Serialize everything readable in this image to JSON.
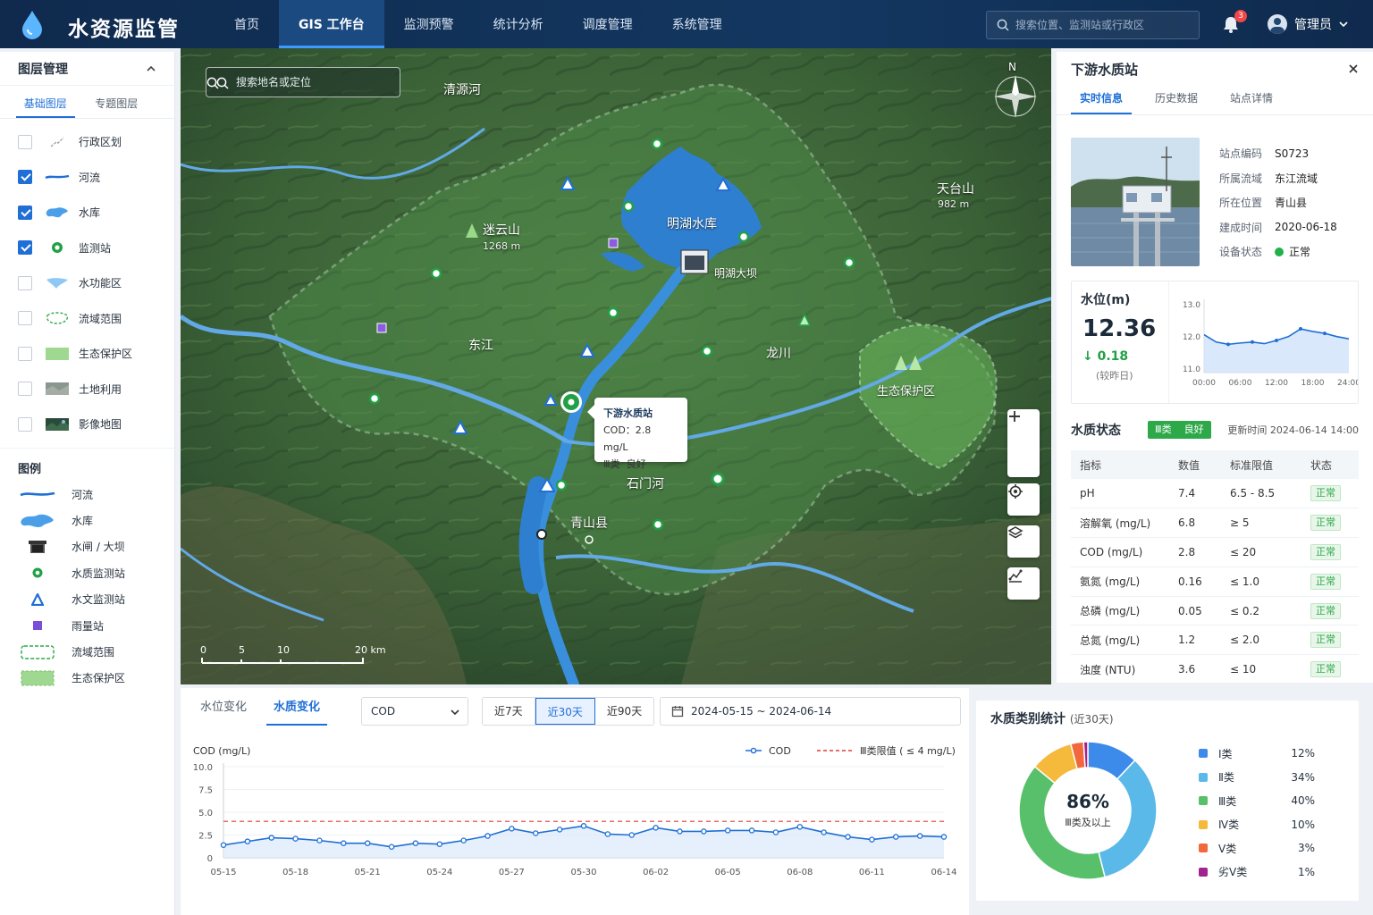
{
  "app": {
    "title": "水资源监管"
  },
  "nav": {
    "items": [
      {
        "label": "首页"
      },
      {
        "label": "GIS 工作台"
      },
      {
        "label": "监测预警"
      },
      {
        "label": "统计分析"
      },
      {
        "label": "调度管理"
      },
      {
        "label": "系统管理"
      }
    ],
    "active_index": 1
  },
  "topbar": {
    "search_placeholder": "搜索位置、监测站或行政区",
    "notification_count": "3",
    "user_name": "管理员"
  },
  "layers": {
    "title": "图层管理",
    "tabs": [
      "基础图层",
      "专题图层"
    ],
    "items": [
      {
        "label": "行政区划",
        "checked": false,
        "icon": "admin-line-icon"
      },
      {
        "label": "河流",
        "checked": true,
        "icon": "river-icon"
      },
      {
        "label": "水库",
        "checked": true,
        "icon": "reservoir-icon"
      },
      {
        "label": "监测站",
        "checked": true,
        "icon": "station-icon"
      },
      {
        "label": "水功能区",
        "checked": false,
        "icon": "function-zone-icon"
      },
      {
        "label": "流域范围",
        "checked": false,
        "icon": "basin-boundary-icon"
      },
      {
        "label": "生态保护区",
        "checked": false,
        "icon": "eco-zone-icon"
      },
      {
        "label": "土地利用",
        "checked": false,
        "icon": "land-use-icon"
      },
      {
        "label": "影像地图",
        "checked": false,
        "icon": "imagery-icon"
      }
    ]
  },
  "legend": {
    "title": "图例",
    "items": [
      {
        "label": "河流"
      },
      {
        "label": "水库"
      },
      {
        "label": "水闸 / 大坝"
      },
      {
        "label": "水质监测站"
      },
      {
        "label": "水文监测站"
      },
      {
        "label": "雨量站"
      },
      {
        "label": "流域范围"
      },
      {
        "label": "生态保护区"
      }
    ]
  },
  "map": {
    "search_placeholder": "搜索地名或定位",
    "compass_label": "N",
    "labels": {
      "qingyuan_river": "清源河",
      "mingshui_reservoir": "明湖水库",
      "mingshui_dam": "明湖大坝",
      "tiantai_mountain": "天台山",
      "tiantai_elev": "982 m",
      "lianyun_mountain": "迷云山",
      "lianyun_elev": "1268 m",
      "dong_river": "东江",
      "long_river": "龙川",
      "eco_zone": "生态保护区",
      "shimen_river": "石门河",
      "qingshan_county": "青山县"
    },
    "tooltip": {
      "title": "下游水质站",
      "line1": "COD：2.8 mg/L",
      "class": "Ⅲ类",
      "quality": "良好"
    },
    "scale": {
      "ticks": [
        "0",
        "5",
        "10",
        "20 km"
      ]
    }
  },
  "station": {
    "title": "下游水质站",
    "tabs": [
      "实时信息",
      "历史数据",
      "站点详情"
    ],
    "info": [
      {
        "k": "站点编码",
        "v": "S0723"
      },
      {
        "k": "所属流域",
        "v": "东江流域"
      },
      {
        "k": "所在位置",
        "v": "青山县"
      },
      {
        "k": "建成时间",
        "v": "2020-06-18"
      },
      {
        "k": "设备状态",
        "v": "正常"
      }
    ],
    "status_color": "#22b04b"
  },
  "water_level": {
    "title": "水位(m)",
    "value": "12.36",
    "delta": "0.18",
    "delta_note": "(较昨日)"
  },
  "water_quality": {
    "title": "水质状态",
    "badge_class": "Ⅲ类",
    "badge_text": "良好",
    "updated": "更新时间  2024-06-14 14:00",
    "columns": [
      "指标",
      "数值",
      "标准限值",
      "状态"
    ],
    "rows": [
      [
        "pH",
        "7.4",
        "6.5 - 8.5",
        "正常"
      ],
      [
        "溶解氧 (mg/L)",
        "6.8",
        "≥ 5",
        "正常"
      ],
      [
        "COD (mg/L)",
        "2.8",
        "≤ 20",
        "正常"
      ],
      [
        "氨氮 (mg/L)",
        "0.16",
        "≤ 1.0",
        "正常"
      ],
      [
        "总磷 (mg/L)",
        "0.05",
        "≤ 0.2",
        "正常"
      ],
      [
        "总氮 (mg/L)",
        "1.2",
        "≤ 2.0",
        "正常"
      ],
      [
        "浊度 (NTU)",
        "3.6",
        "≤ 10",
        "正常"
      ]
    ]
  },
  "bottom": {
    "tabs": [
      "水位变化",
      "水质变化"
    ],
    "active_tab": 1,
    "select_value": "COD",
    "ranges": [
      "近7天",
      "近30天",
      "近90天"
    ],
    "active_range": 1,
    "date_range": "2024-05-15  ~  2024-06-14"
  },
  "donut": {
    "title": "水质类别统计",
    "subtitle": "(近30天)",
    "center_value": "86%",
    "center_label": "Ⅲ类及以上"
  },
  "chart_data": [
    {
      "type": "line",
      "ylabel": "",
      "ylim": [
        11,
        13
      ],
      "x_ticks": [
        "00:00",
        "06:00",
        "12:00",
        "18:00",
        "24:00"
      ],
      "y_ticks": [
        "13.0",
        "12.0",
        "11.0"
      ],
      "x": [
        0,
        2,
        4,
        6,
        8,
        10,
        12,
        14,
        16,
        18,
        20,
        22,
        24
      ],
      "series": [
        {
          "values": [
            12.18,
            11.95,
            11.88,
            11.92,
            11.95,
            11.9,
            12.0,
            12.12,
            12.36,
            12.28,
            12.22,
            12.12,
            12.05
          ]
        }
      ],
      "line_color": "#1f6fd6"
    },
    {
      "type": "line",
      "ylabel": "COD (mg/L)",
      "ylim": [
        0,
        10
      ],
      "y_ticks": [
        "10.0",
        "7.5",
        "5.0",
        "2.5",
        "0"
      ],
      "categories": [
        "05-15",
        "05-16",
        "05-17",
        "05-18",
        "05-19",
        "05-20",
        "05-21",
        "05-22",
        "05-23",
        "05-24",
        "05-25",
        "05-26",
        "05-27",
        "05-28",
        "05-29",
        "05-30",
        "05-31",
        "06-01",
        "06-02",
        "06-03",
        "06-04",
        "06-05",
        "06-06",
        "06-07",
        "06-08",
        "06-09",
        "06-10",
        "06-11",
        "06-12",
        "06-13",
        "06-14"
      ],
      "x_ticks": [
        "05-15",
        "05-18",
        "05-21",
        "05-24",
        "05-27",
        "05-30",
        "06-02",
        "06-05",
        "06-08",
        "06-11",
        "06-14"
      ],
      "series": [
        {
          "name": "COD",
          "values": [
            1.4,
            1.8,
            2.2,
            2.1,
            1.9,
            1.6,
            1.6,
            1.2,
            1.6,
            1.5,
            1.9,
            2.4,
            3.2,
            2.7,
            3.1,
            3.5,
            2.6,
            2.5,
            3.3,
            2.9,
            2.9,
            3.0,
            3.0,
            2.8,
            3.4,
            2.8,
            2.3,
            2.0,
            2.3,
            2.4,
            2.3
          ]
        },
        {
          "name": "Ⅲ类限值 ( ≤ 4 mg/L)",
          "values": [
            4,
            4
          ],
          "style": "dashed"
        }
      ],
      "colors": [
        "#1f6fd6",
        "#e23b3b"
      ]
    },
    {
      "type": "pie",
      "categories": [
        "Ⅰ类",
        "Ⅱ类",
        "Ⅲ类",
        "Ⅳ类",
        "Ⅴ类",
        "劣Ⅴ类"
      ],
      "values": [
        12,
        34,
        40,
        10,
        3,
        1
      ],
      "labels": [
        "12%",
        "34%",
        "40%",
        "10%",
        "3%",
        "1%"
      ],
      "colors": [
        "#3c8bea",
        "#5ab9e8",
        "#58c06a",
        "#f5b93b",
        "#f0683b",
        "#a0238f"
      ]
    }
  ]
}
